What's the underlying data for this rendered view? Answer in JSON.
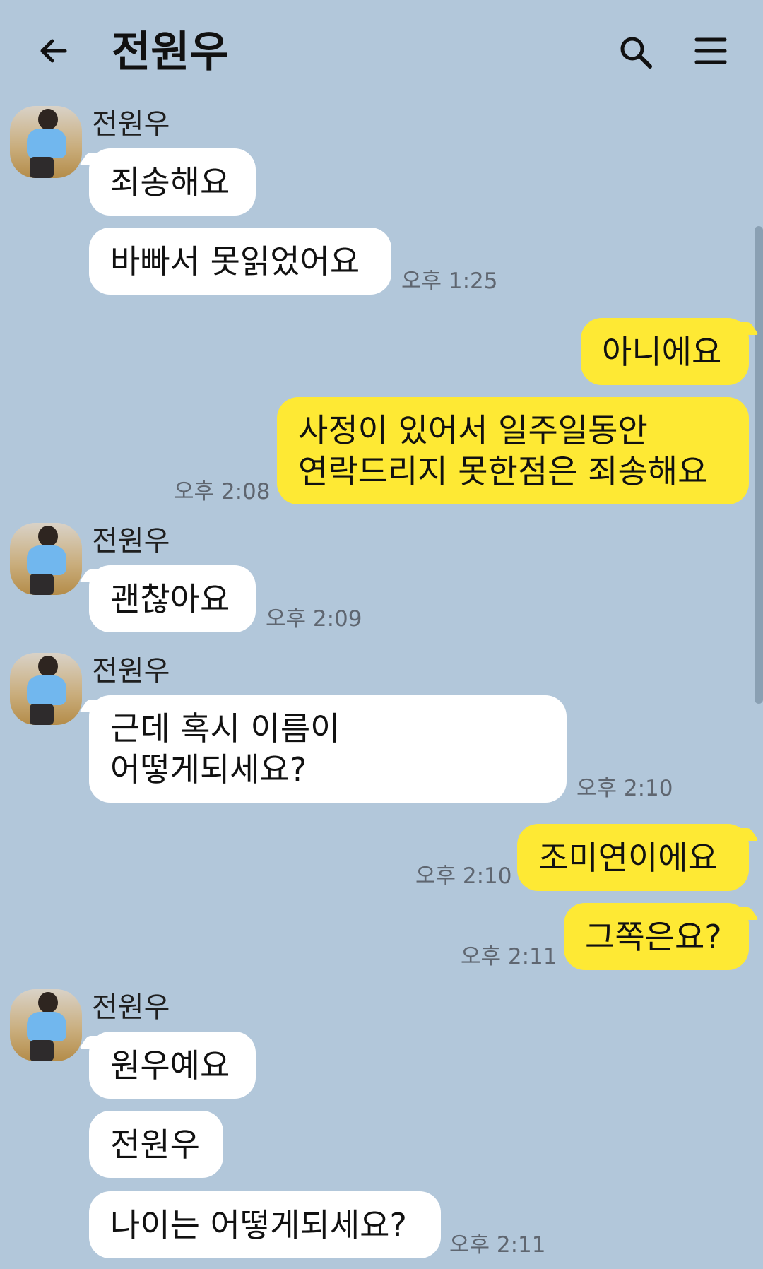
{
  "header": {
    "title": "전원우"
  },
  "messages": {
    "g1": {
      "sender": "전원우",
      "m1": "죄송해요",
      "m2": "바빠서 못읽었어요",
      "time": "오후 1:25"
    },
    "g2": {
      "m1": "아니에요",
      "m2": "사정이 있어서 일주일동안\n연락드리지 못한점은 죄송해요",
      "time": "오후 2:08"
    },
    "g3": {
      "sender": "전원우",
      "m1": "괜찮아요",
      "time": "오후 2:09"
    },
    "g4": {
      "sender": "전원우",
      "m1": "근데 혹시 이름이\n어떻게되세요?",
      "time": "오후 2:10"
    },
    "g5": {
      "m1": "조미연이에요",
      "time": "오후 2:10"
    },
    "g6": {
      "m1": "그쪽은요?",
      "time": "오후 2:11"
    },
    "g7": {
      "sender": "전원우",
      "m1": "원우예요",
      "m2": "전원우",
      "m3": "나이는 어떻게되세요?",
      "time": "오후 2:11"
    }
  },
  "colors": {
    "background": "#b2c7da",
    "incoming_bubble": "#ffffff",
    "outgoing_bubble": "#fee934",
    "timestamp": "#5f6670"
  },
  "icons": {
    "back": "back-arrow-icon",
    "search": "search-icon",
    "menu": "menu-icon"
  }
}
